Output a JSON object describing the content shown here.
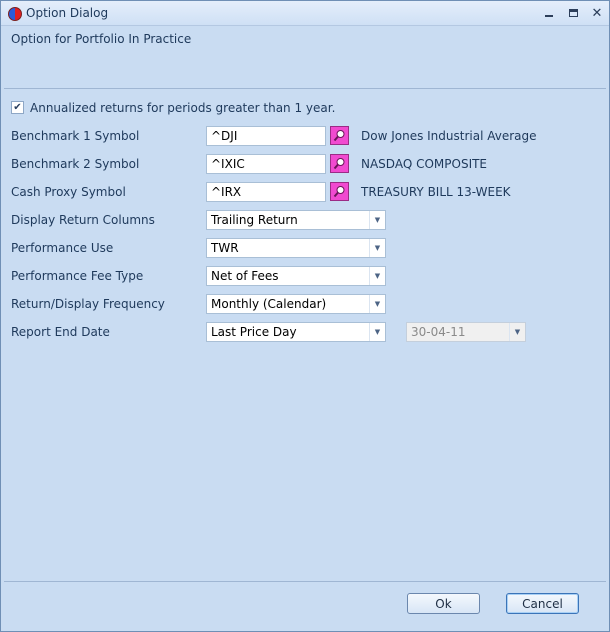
{
  "window": {
    "title": "Option Dialog",
    "header": "Option for Portfolio In Practice"
  },
  "options": {
    "annualized_label": "Annualized returns for periods greater than 1 year.",
    "annualized_checked": true,
    "benchmark1": {
      "label": "Benchmark 1 Symbol",
      "value": "^DJI",
      "description": "Dow Jones Industrial Average"
    },
    "benchmark2": {
      "label": "Benchmark 2 Symbol",
      "value": "^IXIC",
      "description": "NASDAQ COMPOSITE"
    },
    "cash_proxy": {
      "label": "Cash Proxy Symbol",
      "value": "^IRX",
      "description": "TREASURY BILL 13-WEEK"
    },
    "display_return": {
      "label": "Display Return Columns",
      "value": "Trailing Return"
    },
    "performance_use": {
      "label": "Performance Use",
      "value": "TWR"
    },
    "fee_type": {
      "label": "Performance Fee Type",
      "value": "Net of Fees"
    },
    "frequency": {
      "label": "Return/Display Frequency",
      "value": "Monthly (Calendar)"
    },
    "report_end": {
      "label": "Report End Date",
      "value": "Last Price Day",
      "date": "30-04-11"
    }
  },
  "buttons": {
    "ok": "Ok",
    "cancel": "Cancel"
  },
  "colors": {
    "lookup_button": "#f14ad0",
    "dialog_bg": "#c9dcf2"
  }
}
